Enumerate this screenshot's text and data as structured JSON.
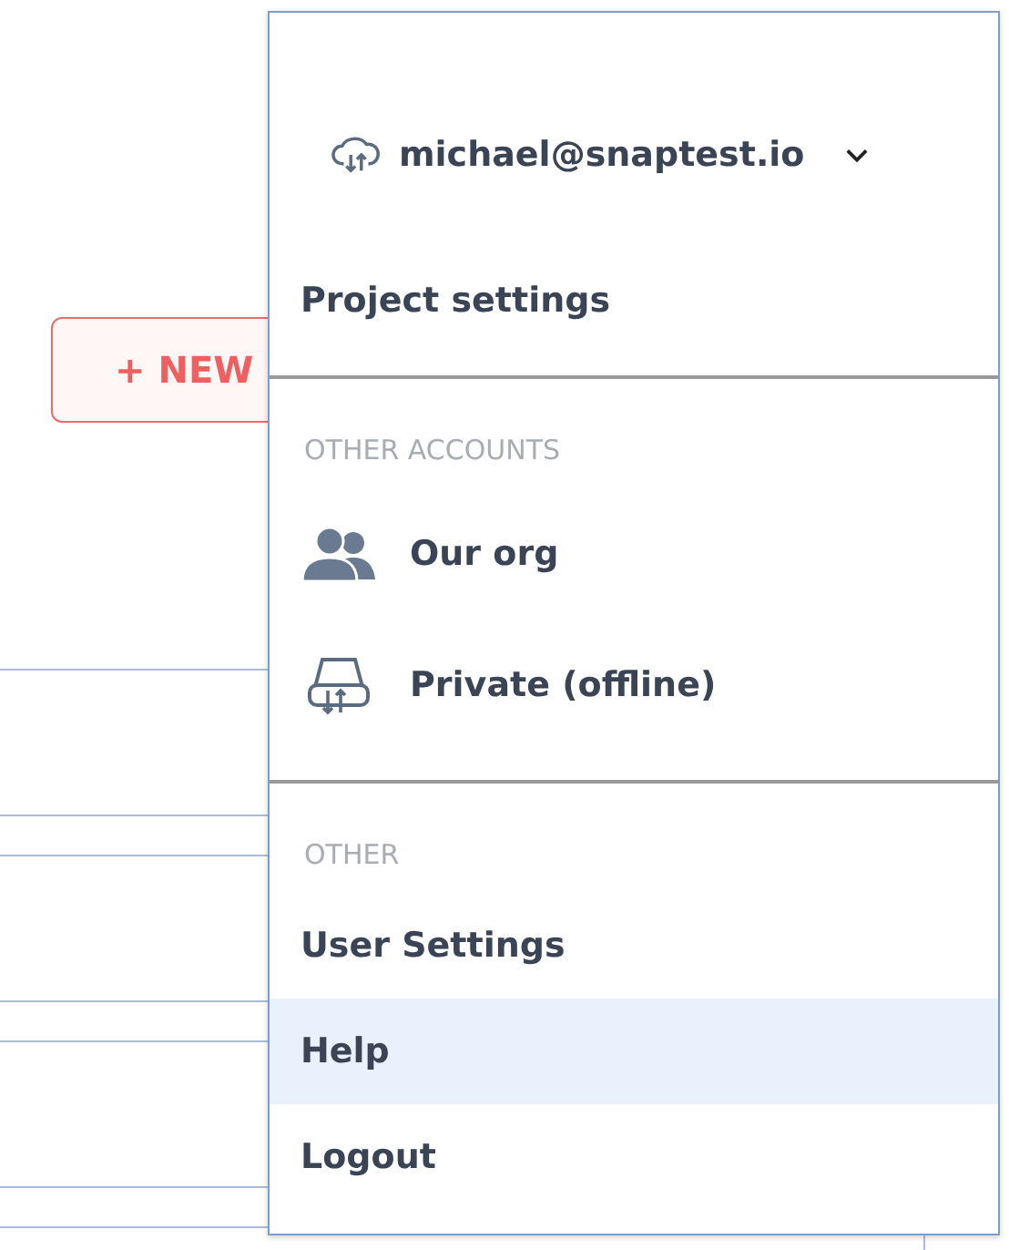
{
  "new_button": {
    "label": "+ NEW"
  },
  "cards": [
    {
      "kind": "card"
    },
    {
      "kind": "card"
    },
    {
      "kind": "card"
    },
    {
      "kind": "card"
    }
  ],
  "account_menu": {
    "account": {
      "email": "michael@snaptest.io",
      "kind": "cloud"
    },
    "sections": [
      {
        "items": [
          {
            "label": "Project settings",
            "selected": false
          }
        ]
      },
      {
        "heading": "OTHER ACCOUNTS",
        "items": [
          {
            "label": "Our org",
            "kind": "users",
            "selected": false
          },
          {
            "label": "Private (offline)",
            "kind": "drive",
            "selected": false
          }
        ]
      },
      {
        "heading": "OTHER",
        "items": [
          {
            "label": "User Settings",
            "selected": false
          },
          {
            "label": "Help",
            "selected": true
          },
          {
            "label": "Logout",
            "selected": false
          }
        ]
      }
    ]
  }
}
